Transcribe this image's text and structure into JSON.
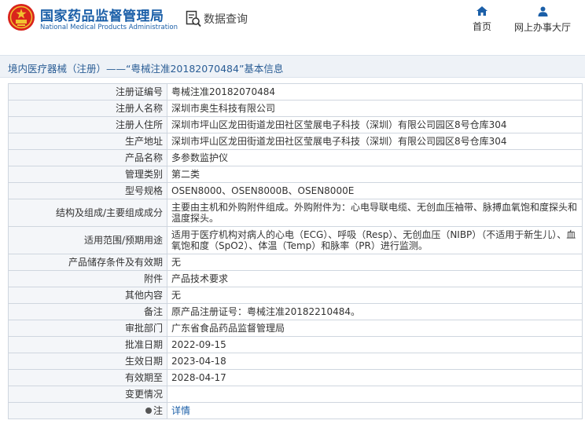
{
  "header": {
    "org_name_cn": "国家药品监督管理局",
    "org_name_en": "National Medical Products Administration",
    "section": "数据查询",
    "nav": {
      "home": "首页",
      "online_hall": "网上办事大厅"
    },
    "brand_color": "#1b5fa8"
  },
  "page_title": "境内医疗器械（注册）——“粤械注准20182070484”基本信息",
  "fields": [
    {
      "label": "注册证编号",
      "value": "粤械注准20182070484"
    },
    {
      "label": "注册人名称",
      "value": "深圳市奥生科技有限公司"
    },
    {
      "label": "注册人住所",
      "value": "深圳市坪山区龙田街道龙田社区莹展电子科技（深圳）有限公司园区8号仓库304"
    },
    {
      "label": "生产地址",
      "value": "深圳市坪山区龙田街道龙田社区莹展电子科技（深圳）有限公司园区8号仓库304"
    },
    {
      "label": "产品名称",
      "value": "多参数监护仪"
    },
    {
      "label": "管理类别",
      "value": "第二类"
    },
    {
      "label": "型号规格",
      "value": "OSEN8000、OSEN8000B、OSEN8000E"
    },
    {
      "label": "结构及组成/主要组成成分",
      "value": "主要由主机和外购附件组成。外购附件为：心电导联电缆、无创血压袖带、脉搏血氧饱和度探头和温度探头。"
    },
    {
      "label": "适用范围/预期用途",
      "value": "适用于医疗机构对病人的心电（ECG）、呼吸（Resp）、无创血压（NIBP）（不适用于新生儿）、血氧饱和度（SpO2）、体温（Temp）和脉率（PR）进行监测。"
    },
    {
      "label": "产品储存条件及有效期",
      "value": "无"
    },
    {
      "label": "附件",
      "value": "产品技术要求"
    },
    {
      "label": "其他内容",
      "value": "无"
    },
    {
      "label": "备注",
      "value": "原产品注册证号：粤械注准20182210484。"
    },
    {
      "label": "审批部门",
      "value": "广东省食品药品监督管理局"
    },
    {
      "label": "批准日期",
      "value": "2022-09-15"
    },
    {
      "label": "生效日期",
      "value": "2023-04-18"
    },
    {
      "label": "有效期至",
      "value": "2028-04-17"
    },
    {
      "label": "变更情况",
      "value": ""
    }
  ],
  "note": {
    "label": "注",
    "link": "详情"
  }
}
